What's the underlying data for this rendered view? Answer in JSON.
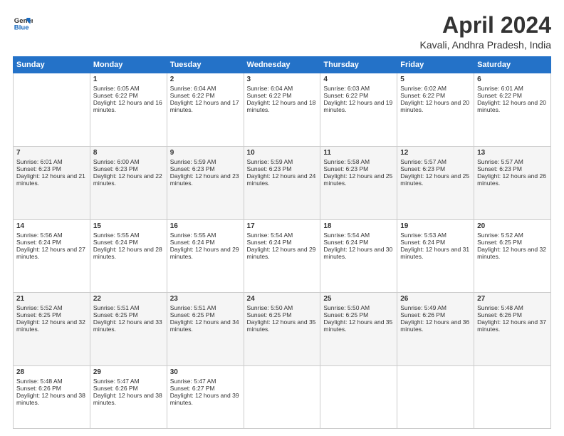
{
  "header": {
    "logo_line1": "General",
    "logo_line2": "Blue",
    "month_title": "April 2024",
    "location": "Kavali, Andhra Pradesh, India"
  },
  "weekdays": [
    "Sunday",
    "Monday",
    "Tuesday",
    "Wednesday",
    "Thursday",
    "Friday",
    "Saturday"
  ],
  "weeks": [
    [
      {
        "day": "",
        "sunrise": "",
        "sunset": "",
        "daylight": ""
      },
      {
        "day": "1",
        "sunrise": "Sunrise: 6:05 AM",
        "sunset": "Sunset: 6:22 PM",
        "daylight": "Daylight: 12 hours and 16 minutes."
      },
      {
        "day": "2",
        "sunrise": "Sunrise: 6:04 AM",
        "sunset": "Sunset: 6:22 PM",
        "daylight": "Daylight: 12 hours and 17 minutes."
      },
      {
        "day": "3",
        "sunrise": "Sunrise: 6:04 AM",
        "sunset": "Sunset: 6:22 PM",
        "daylight": "Daylight: 12 hours and 18 minutes."
      },
      {
        "day": "4",
        "sunrise": "Sunrise: 6:03 AM",
        "sunset": "Sunset: 6:22 PM",
        "daylight": "Daylight: 12 hours and 19 minutes."
      },
      {
        "day": "5",
        "sunrise": "Sunrise: 6:02 AM",
        "sunset": "Sunset: 6:22 PM",
        "daylight": "Daylight: 12 hours and 20 minutes."
      },
      {
        "day": "6",
        "sunrise": "Sunrise: 6:01 AM",
        "sunset": "Sunset: 6:22 PM",
        "daylight": "Daylight: 12 hours and 20 minutes."
      }
    ],
    [
      {
        "day": "7",
        "sunrise": "Sunrise: 6:01 AM",
        "sunset": "Sunset: 6:23 PM",
        "daylight": "Daylight: 12 hours and 21 minutes."
      },
      {
        "day": "8",
        "sunrise": "Sunrise: 6:00 AM",
        "sunset": "Sunset: 6:23 PM",
        "daylight": "Daylight: 12 hours and 22 minutes."
      },
      {
        "day": "9",
        "sunrise": "Sunrise: 5:59 AM",
        "sunset": "Sunset: 6:23 PM",
        "daylight": "Daylight: 12 hours and 23 minutes."
      },
      {
        "day": "10",
        "sunrise": "Sunrise: 5:59 AM",
        "sunset": "Sunset: 6:23 PM",
        "daylight": "Daylight: 12 hours and 24 minutes."
      },
      {
        "day": "11",
        "sunrise": "Sunrise: 5:58 AM",
        "sunset": "Sunset: 6:23 PM",
        "daylight": "Daylight: 12 hours and 25 minutes."
      },
      {
        "day": "12",
        "sunrise": "Sunrise: 5:57 AM",
        "sunset": "Sunset: 6:23 PM",
        "daylight": "Daylight: 12 hours and 25 minutes."
      },
      {
        "day": "13",
        "sunrise": "Sunrise: 5:57 AM",
        "sunset": "Sunset: 6:23 PM",
        "daylight": "Daylight: 12 hours and 26 minutes."
      }
    ],
    [
      {
        "day": "14",
        "sunrise": "Sunrise: 5:56 AM",
        "sunset": "Sunset: 6:24 PM",
        "daylight": "Daylight: 12 hours and 27 minutes."
      },
      {
        "day": "15",
        "sunrise": "Sunrise: 5:55 AM",
        "sunset": "Sunset: 6:24 PM",
        "daylight": "Daylight: 12 hours and 28 minutes."
      },
      {
        "day": "16",
        "sunrise": "Sunrise: 5:55 AM",
        "sunset": "Sunset: 6:24 PM",
        "daylight": "Daylight: 12 hours and 29 minutes."
      },
      {
        "day": "17",
        "sunrise": "Sunrise: 5:54 AM",
        "sunset": "Sunset: 6:24 PM",
        "daylight": "Daylight: 12 hours and 29 minutes."
      },
      {
        "day": "18",
        "sunrise": "Sunrise: 5:54 AM",
        "sunset": "Sunset: 6:24 PM",
        "daylight": "Daylight: 12 hours and 30 minutes."
      },
      {
        "day": "19",
        "sunrise": "Sunrise: 5:53 AM",
        "sunset": "Sunset: 6:24 PM",
        "daylight": "Daylight: 12 hours and 31 minutes."
      },
      {
        "day": "20",
        "sunrise": "Sunrise: 5:52 AM",
        "sunset": "Sunset: 6:25 PM",
        "daylight": "Daylight: 12 hours and 32 minutes."
      }
    ],
    [
      {
        "day": "21",
        "sunrise": "Sunrise: 5:52 AM",
        "sunset": "Sunset: 6:25 PM",
        "daylight": "Daylight: 12 hours and 32 minutes."
      },
      {
        "day": "22",
        "sunrise": "Sunrise: 5:51 AM",
        "sunset": "Sunset: 6:25 PM",
        "daylight": "Daylight: 12 hours and 33 minutes."
      },
      {
        "day": "23",
        "sunrise": "Sunrise: 5:51 AM",
        "sunset": "Sunset: 6:25 PM",
        "daylight": "Daylight: 12 hours and 34 minutes."
      },
      {
        "day": "24",
        "sunrise": "Sunrise: 5:50 AM",
        "sunset": "Sunset: 6:25 PM",
        "daylight": "Daylight: 12 hours and 35 minutes."
      },
      {
        "day": "25",
        "sunrise": "Sunrise: 5:50 AM",
        "sunset": "Sunset: 6:25 PM",
        "daylight": "Daylight: 12 hours and 35 minutes."
      },
      {
        "day": "26",
        "sunrise": "Sunrise: 5:49 AM",
        "sunset": "Sunset: 6:26 PM",
        "daylight": "Daylight: 12 hours and 36 minutes."
      },
      {
        "day": "27",
        "sunrise": "Sunrise: 5:48 AM",
        "sunset": "Sunset: 6:26 PM",
        "daylight": "Daylight: 12 hours and 37 minutes."
      }
    ],
    [
      {
        "day": "28",
        "sunrise": "Sunrise: 5:48 AM",
        "sunset": "Sunset: 6:26 PM",
        "daylight": "Daylight: 12 hours and 38 minutes."
      },
      {
        "day": "29",
        "sunrise": "Sunrise: 5:47 AM",
        "sunset": "Sunset: 6:26 PM",
        "daylight": "Daylight: 12 hours and 38 minutes."
      },
      {
        "day": "30",
        "sunrise": "Sunrise: 5:47 AM",
        "sunset": "Sunset: 6:27 PM",
        "daylight": "Daylight: 12 hours and 39 minutes."
      },
      {
        "day": "",
        "sunrise": "",
        "sunset": "",
        "daylight": ""
      },
      {
        "day": "",
        "sunrise": "",
        "sunset": "",
        "daylight": ""
      },
      {
        "day": "",
        "sunrise": "",
        "sunset": "",
        "daylight": ""
      },
      {
        "day": "",
        "sunrise": "",
        "sunset": "",
        "daylight": ""
      }
    ]
  ]
}
